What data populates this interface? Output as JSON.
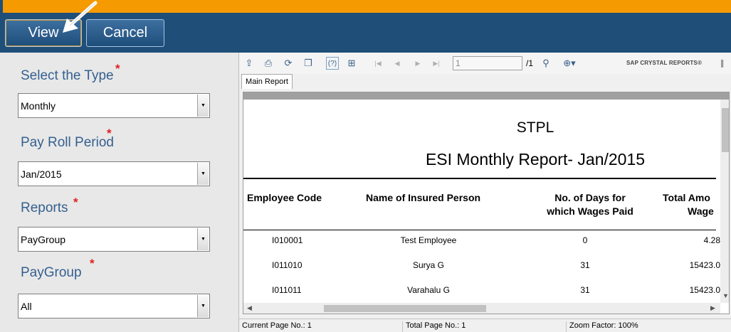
{
  "header": {
    "view_label": "View",
    "cancel_label": "Cancel"
  },
  "form": {
    "type_label": "Select the Type",
    "type_value": "Monthly",
    "period_label": "Pay Roll Period",
    "period_value": "Jan/2015",
    "reports_label": "Reports",
    "reports_value": "PayGroup",
    "paygroup_label": "PayGroup",
    "paygroup_value": "All",
    "required_mark": "*"
  },
  "viewer": {
    "page_input": "1",
    "page_total": "/1",
    "brand": "SAP CRYSTAL REPORTS®",
    "tab_label": "Main Report",
    "icons": [
      "export-icon",
      "print-icon",
      "refresh-icon",
      "copy-icon",
      "help-icon",
      "group-tree-icon",
      "first-page-icon",
      "prev-page-icon",
      "next-page-icon",
      "last-page-icon",
      "find-icon",
      "zoom-icon"
    ]
  },
  "report": {
    "company": "STPL",
    "title": "ESI Monthly Report- Jan/2015",
    "columns": [
      "Employee Code",
      "Name of Insured Person",
      "No. of Days for",
      "which Wages Paid",
      "Total Amo",
      "Wage"
    ],
    "rows": [
      {
        "code": "I010001",
        "name": "Test Employee",
        "days": "0",
        "total": "4.28"
      },
      {
        "code": "I011010",
        "name": "Surya G",
        "days": "31",
        "total": "15423.0"
      },
      {
        "code": "I011011",
        "name": "Varahalu G",
        "days": "31",
        "total": "15423.0"
      }
    ]
  },
  "status": {
    "current_page": "Current Page No.: 1",
    "total_page": "Total Page No.: 1",
    "zoom": "Zoom Factor: 100%"
  },
  "colors": {
    "header_bg": "#1f4e79",
    "accent_strip": "#f59a00",
    "label_text": "#356090",
    "required": "#e02020"
  }
}
